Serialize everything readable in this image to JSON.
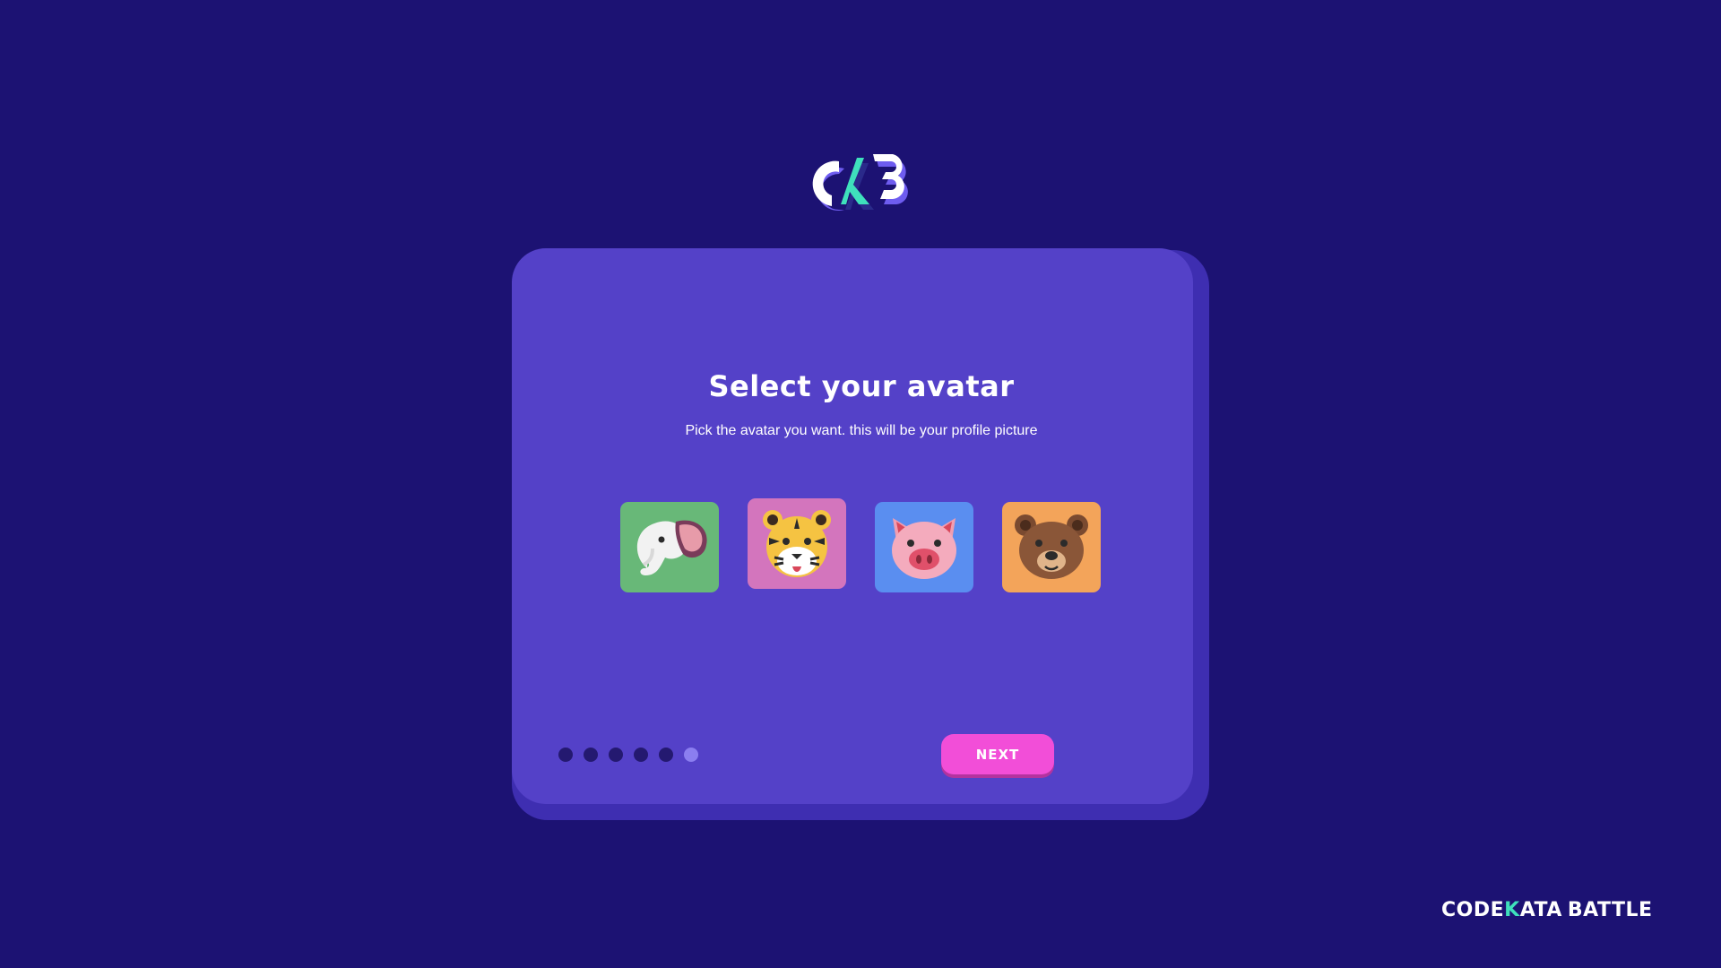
{
  "logo": {
    "icon": "ckb-logo-icon"
  },
  "card": {
    "title": "Select your avatar",
    "subtitle": "Pick the avatar you want. this will be your profile picture"
  },
  "avatars": [
    {
      "name": "elephant",
      "background": "#68b878",
      "icon": "elephant-icon",
      "selected": false
    },
    {
      "name": "tiger",
      "background": "#d375bd",
      "icon": "tiger-icon",
      "selected": true
    },
    {
      "name": "pig",
      "background": "#5a8ef0",
      "icon": "pig-icon",
      "selected": false
    },
    {
      "name": "bear",
      "background": "#f3a45a",
      "icon": "bear-icon",
      "selected": false
    }
  ],
  "stepper": {
    "total_steps": 6,
    "current_step": 6
  },
  "buttons": {
    "next_label": "NEXT"
  },
  "brand": {
    "part1": "CODE",
    "part2": "K",
    "part3": "ATA",
    "part4": "BATTLE"
  },
  "colors": {
    "background": "#1c1273",
    "card": "#5441c8",
    "card_shadow": "#3e2eb1",
    "accent_pink": "#f24ed8",
    "accent_teal": "#3fe0bc",
    "dot_inactive": "#241970",
    "dot_active": "#8b7ef0"
  }
}
